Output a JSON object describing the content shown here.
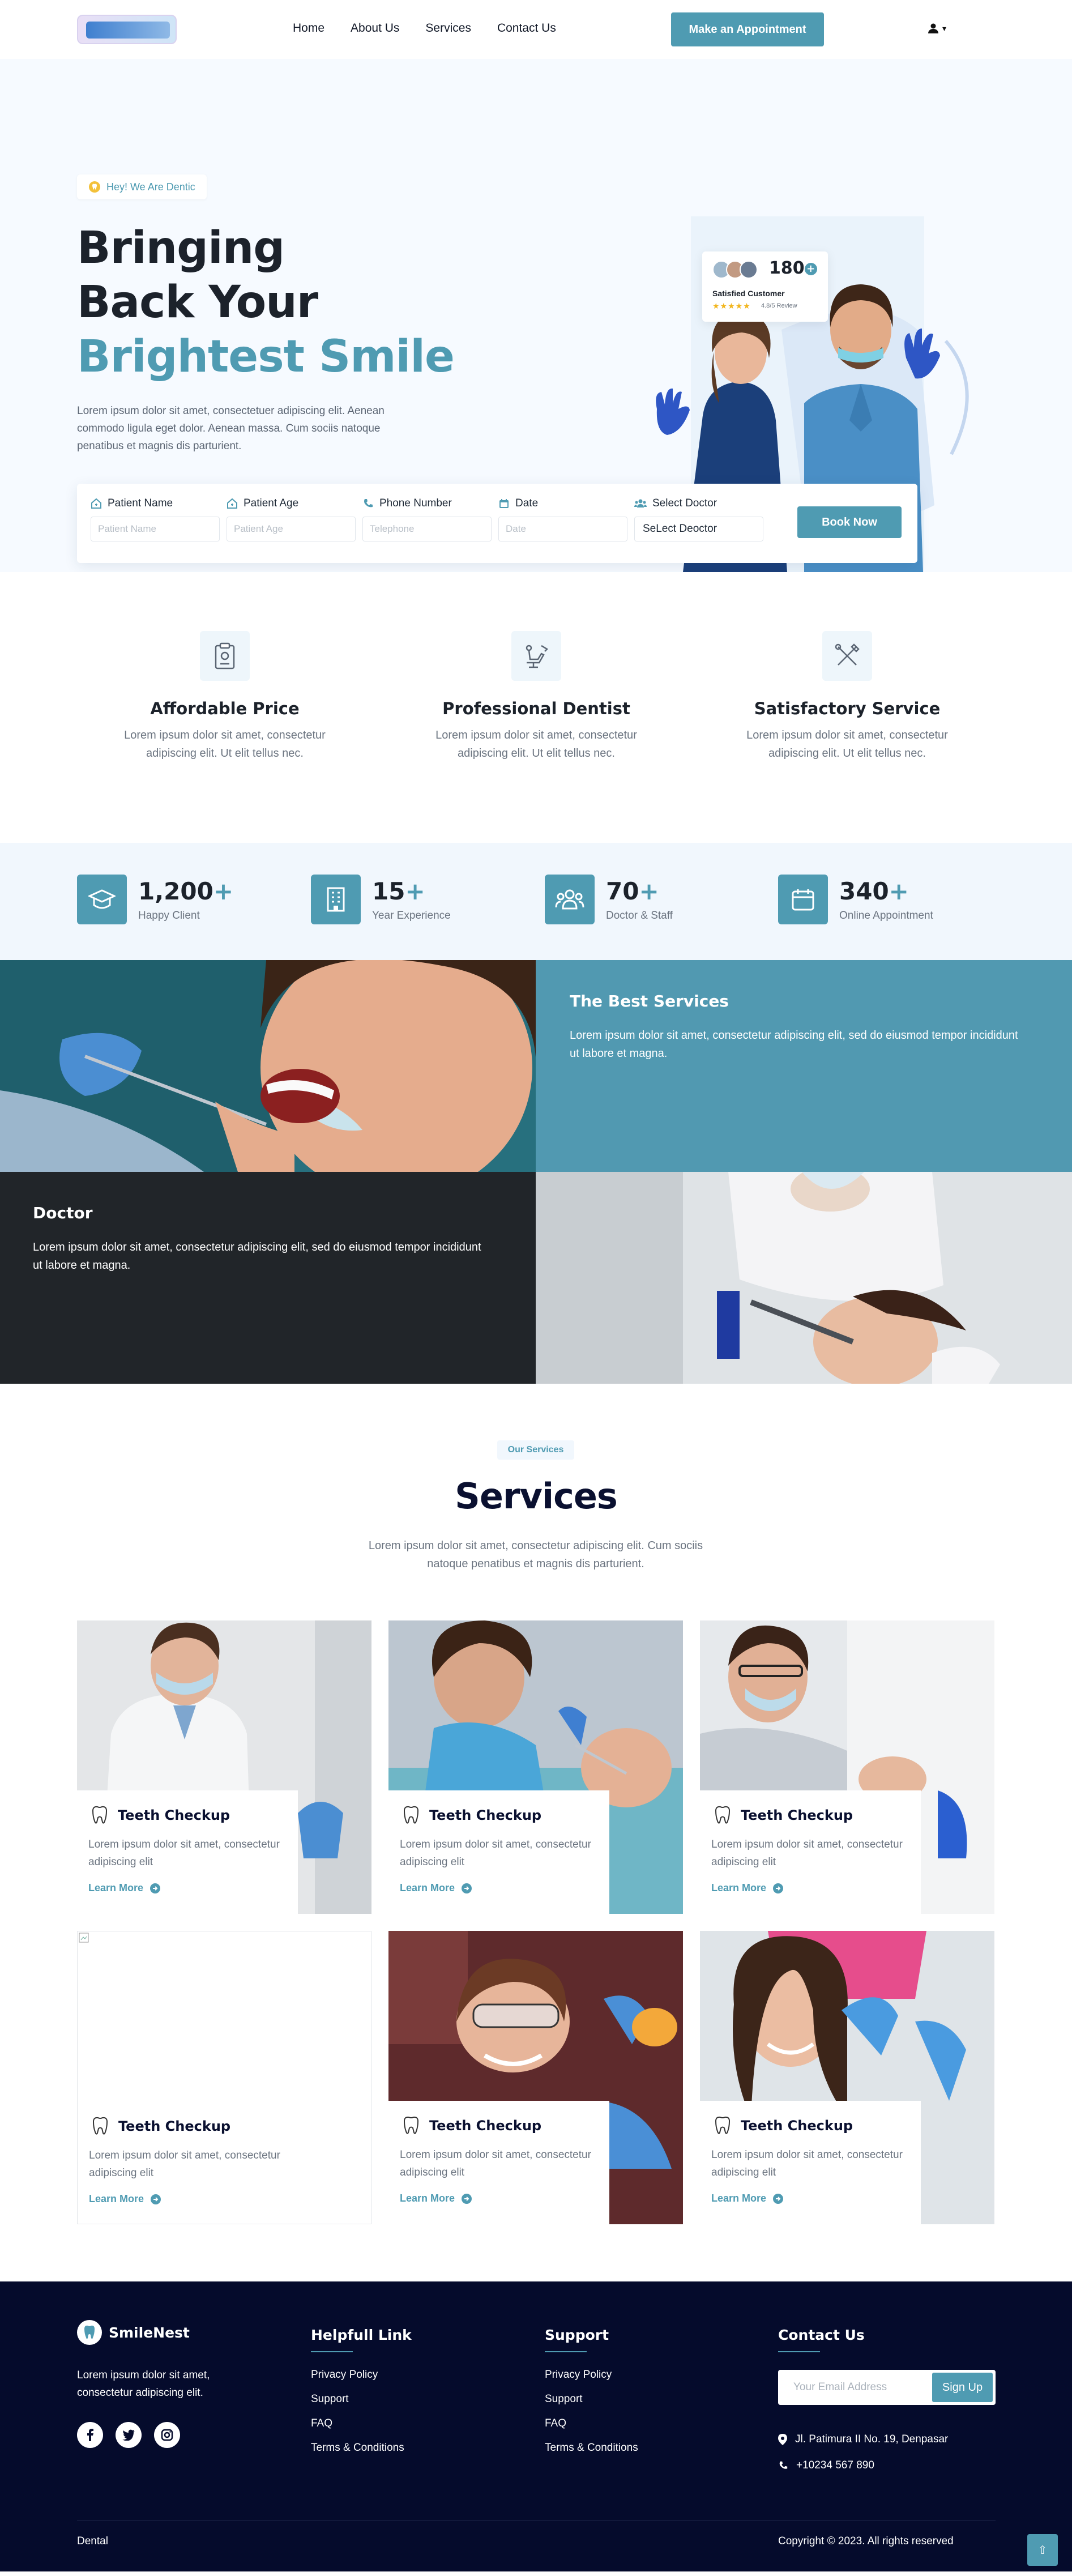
{
  "nav": {
    "menu": [
      "Home",
      "About Us",
      "Services",
      "Contact Us"
    ],
    "cta": "Make an Appointment",
    "user_caret": "▾"
  },
  "hero": {
    "badge": "Hey! We Are Dentic",
    "title_line1": "Bringing",
    "title_line2": "Back Your",
    "title_accent": "Brightest Smile",
    "description": "Lorem ipsum dolor sit amet, consectetuer adipiscing elit. Aenean commodo ligula eget dolor. Aenean massa. Cum sociis natoque penatibus et magnis dis parturient.",
    "rating_card": {
      "count": "180",
      "plus": "+",
      "label": "Satisfied Customer",
      "review": "4.8/5 Review",
      "stars": 4.8
    }
  },
  "booking": {
    "fields": [
      {
        "label": "Patient Name",
        "placeholder": "Patient Name"
      },
      {
        "label": "Patient Age",
        "placeholder": "Patient Age"
      },
      {
        "label": "Phone Number",
        "placeholder": "Telephone"
      },
      {
        "label": "Date",
        "placeholder": "Date"
      }
    ],
    "doctor_label": "Select Doctor",
    "doctor_value": "SeLect Deoctor",
    "submit": "Book Now"
  },
  "features": [
    {
      "title": "Affordable Price",
      "desc": "Lorem ipsum dolor sit amet, consectetur adipiscing elit. Ut elit tellus nec.",
      "icon": "clipboard-icon"
    },
    {
      "title": "Professional Dentist",
      "desc": "Lorem ipsum dolor sit amet, consectetur adipiscing elit. Ut elit tellus nec.",
      "icon": "dental-chair-icon"
    },
    {
      "title": "Satisfactory Service",
      "desc": "Lorem ipsum dolor sit amet, consectetur adipiscing elit. Ut elit tellus nec.",
      "icon": "dental-tools-icon"
    }
  ],
  "stats": [
    {
      "value": "1,200",
      "plus": "+",
      "label": "Happy Client",
      "icon": "graduation-cap-icon"
    },
    {
      "value": "15",
      "plus": "+",
      "label": "Year Experience",
      "icon": "building-icon"
    },
    {
      "value": "70",
      "plus": "+",
      "label": "Doctor & Staff",
      "icon": "team-icon"
    },
    {
      "value": "340",
      "plus": "+",
      "label": "Online Appointment",
      "icon": "calendar-icon"
    }
  ],
  "best_services": {
    "title": "The Best Services",
    "desc": "Lorem ipsum dolor sit amet, consectetur adipiscing elit, sed do eiusmod tempor incididunt ut labore et magna."
  },
  "doctor_block": {
    "title": "Doctor",
    "desc": "Lorem ipsum dolor sit amet, consectetur adipiscing elit, sed do eiusmod tempor incididunt ut labore et magna."
  },
  "services": {
    "badge": "Our Services",
    "title": "Services",
    "desc": "Lorem ipsum dolor sit amet, consectetur adipiscing elit. Cum sociis natoque penatibus et magnis dis parturient.",
    "cards": [
      {
        "title": "Teeth Checkup",
        "desc": "Lorem ipsum dolor sit amet, consectetur adipiscing elit",
        "link": "Learn More"
      },
      {
        "title": "Teeth Checkup",
        "desc": "Lorem ipsum dolor sit amet, consectetur adipiscing elit",
        "link": "Learn More"
      },
      {
        "title": "Teeth Checkup",
        "desc": "Lorem ipsum dolor sit amet, consectetur adipiscing elit",
        "link": "Learn More"
      },
      {
        "title": "Teeth Checkup",
        "desc": "Lorem ipsum dolor sit amet, consectetur adipiscing elit",
        "link": "Learn More"
      },
      {
        "title": "Teeth Checkup",
        "desc": "Lorem ipsum dolor sit amet, consectetur adipiscing elit",
        "link": "Learn More"
      },
      {
        "title": "Teeth Checkup",
        "desc": "Lorem ipsum dolor sit amet, consectetur adipiscing elit",
        "link": "Learn More"
      }
    ]
  },
  "footer": {
    "brand": "SmileNest",
    "about": "Lorem ipsum dolor sit amet, consectetur adipiscing elit.",
    "helpful": {
      "title": "Helpfull Link",
      "links": [
        "Privacy Policy",
        "Support",
        "FAQ",
        "Terms & Conditions"
      ]
    },
    "support": {
      "title": "Support",
      "links": [
        "Privacy Policy",
        "Support",
        "FAQ",
        "Terms & Conditions"
      ]
    },
    "contact": {
      "title": "Contact Us",
      "email_placeholder": "Your Email Address",
      "signup": "Sign Up",
      "address": "Jl. Patimura II No. 19, Denpasar",
      "phone": "+10234 567 890"
    },
    "bottom_left": "Dental",
    "copyright": "Copyright © 2023. All rights reserved",
    "to_top": "⇧"
  },
  "colors": {
    "accent": "#4f9bb2",
    "dark": "#212529",
    "footer": "#050b2c",
    "hero_bg": "#f6faff"
  }
}
